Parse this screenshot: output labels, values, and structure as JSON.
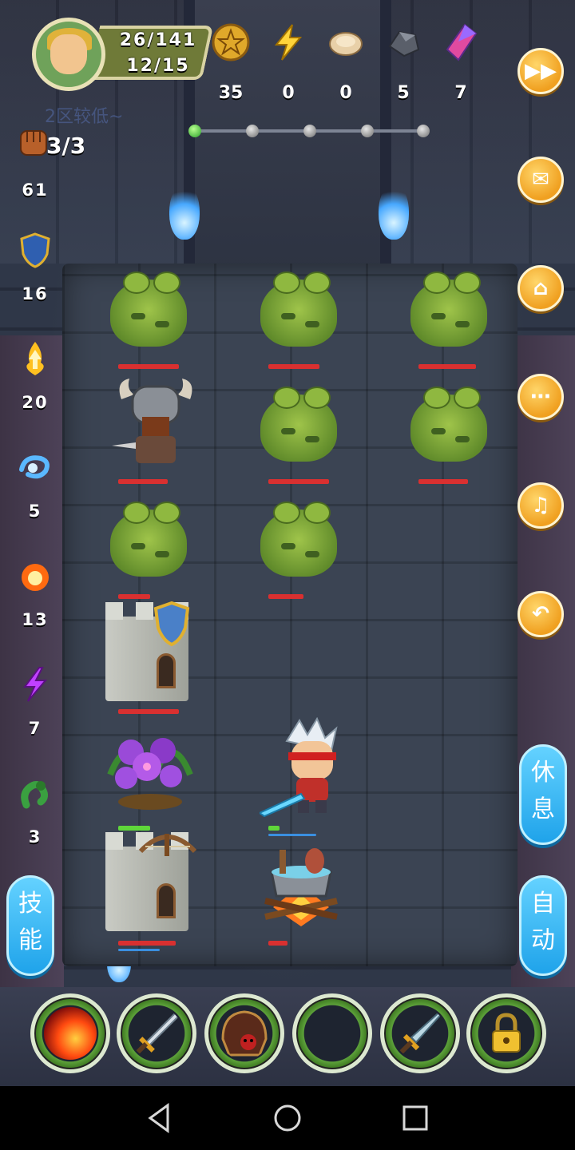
{
  "hud": {
    "hp": "26/141",
    "mp": "12/15",
    "resources": [
      {
        "icon": "gold-coin-icon",
        "value": "35"
      },
      {
        "icon": "lightning-icon",
        "value": "0"
      },
      {
        "icon": "bread-icon",
        "value": "0"
      },
      {
        "icon": "ore-icon",
        "value": "5"
      },
      {
        "icon": "crystal-icon",
        "value": "7"
      }
    ],
    "faded_text": "2区较低~",
    "progress_nodes": 5,
    "progress_current": 1
  },
  "left_stats": {
    "fist": "3/3",
    "attack": "61",
    "defense": "16",
    "fire_up": "20",
    "water": "5",
    "fireball": "13",
    "lightning": "7",
    "poison": "3"
  },
  "right_menu": {
    "fast_forward": "fast-forward-icon",
    "mail": "mail-icon",
    "home": "home-icon",
    "chat": "chat-icon",
    "sound": "sound-icon",
    "undo": "undo-icon",
    "rest_label_1": "休",
    "rest_label_2": "息",
    "auto_label_1": "自",
    "auto_label_2": "动"
  },
  "skill_button": {
    "line1": "技",
    "line2": "能"
  },
  "skills": [
    "fire-slash-icon",
    "dagger-icon",
    "helmet-icon",
    "empty-slot",
    "sword-icon",
    "lock-icon"
  ],
  "colors": {
    "accent_orange": "#f0a020",
    "accent_blue": "#1fa3ea",
    "hp_red": "#d93030",
    "hp_green": "#5fd63a"
  }
}
